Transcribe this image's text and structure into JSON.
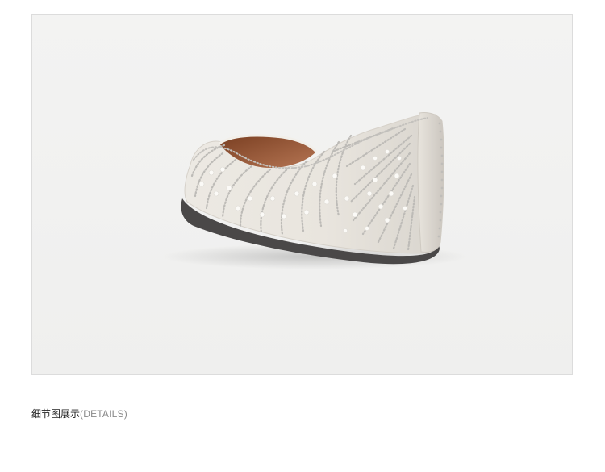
{
  "caption": {
    "main": "细节图展示",
    "sub": "(DETAILS)"
  },
  "image": {
    "icon": "beaded-ballet-flat-shoe",
    "colors": {
      "background": "#f1f1f0",
      "shoe_body": "#e7e3dc",
      "lining": "#9a5a38",
      "sole": "#4a4848",
      "beads": "#c9c7c3",
      "pearls": "#fbfaf7"
    }
  }
}
